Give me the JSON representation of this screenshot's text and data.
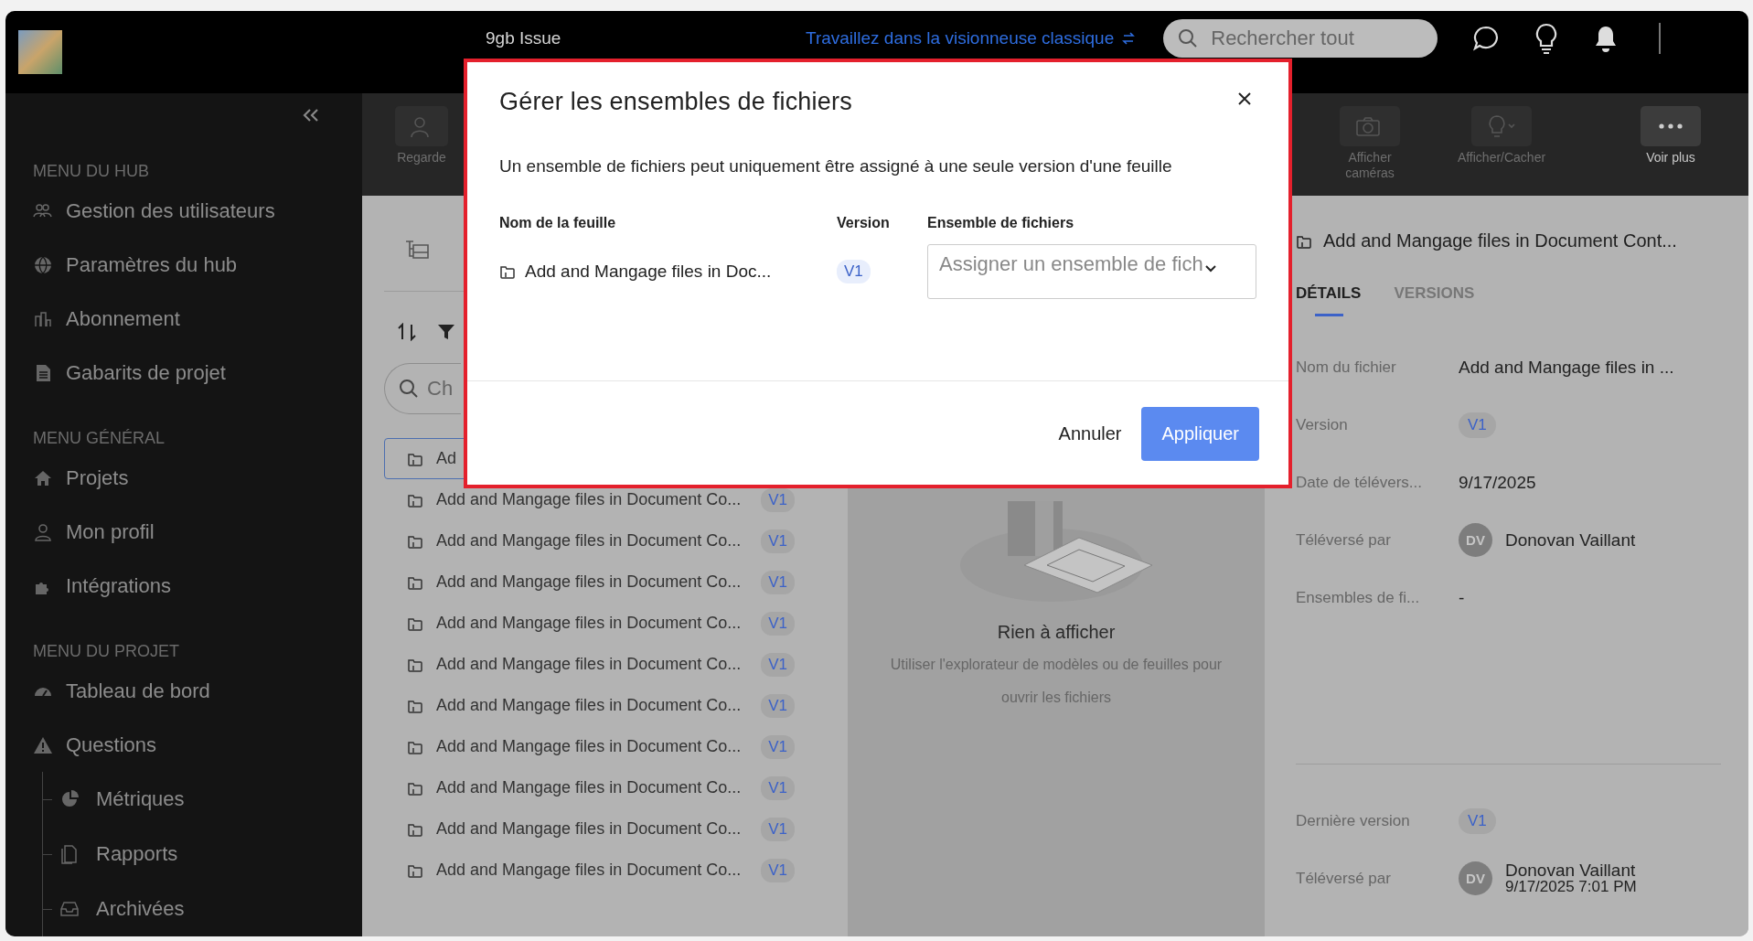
{
  "top_bar": {
    "project_title": "9gb Issue",
    "classic_viewer_link": "Travaillez dans la visionneuse classique",
    "search": {
      "placeholder": "Rechercher tout"
    }
  },
  "sidebar": {
    "sections": [
      {
        "heading": "MENU DU HUB",
        "items": [
          {
            "label": "Gestion des utilisateurs"
          },
          {
            "label": "Paramètres du hub"
          },
          {
            "label": "Abonnement"
          },
          {
            "label": "Gabarits de projet"
          }
        ]
      },
      {
        "heading": "MENU GÉNÉRAL",
        "items": [
          {
            "label": "Projets"
          },
          {
            "label": "Mon profil"
          },
          {
            "label": "Intégrations"
          }
        ]
      },
      {
        "heading": "MENU DU PROJET",
        "items": [
          {
            "label": "Tableau de bord"
          },
          {
            "label": "Questions",
            "children": [
              {
                "label": "Métriques"
              },
              {
                "label": "Rapports"
              },
              {
                "label": "Archivées"
              }
            ]
          }
        ]
      }
    ]
  },
  "toolbar": {
    "buttons": [
      {
        "label": "Regarde"
      },
      {
        "label": "Afficher caméras"
      },
      {
        "label": "Afficher/Cacher"
      },
      {
        "label": "Voir plus"
      }
    ]
  },
  "file_list": {
    "search": {
      "placeholder": "Ch"
    },
    "rows": [
      {
        "name": "Ad",
        "selected": true
      },
      {
        "name": "Add and Mangage files in Document Co...",
        "version": "V1",
        "selected": false
      },
      {
        "name": "Add and Mangage files in Document Co...",
        "version": "V1",
        "selected": false
      },
      {
        "name": "Add and Mangage files in Document Co...",
        "version": "V1",
        "selected": false
      },
      {
        "name": "Add and Mangage files in Document Co...",
        "version": "V1",
        "selected": false
      },
      {
        "name": "Add and Mangage files in Document Co...",
        "version": "V1",
        "selected": false
      },
      {
        "name": "Add and Mangage files in Document Co...",
        "version": "V1",
        "selected": false
      },
      {
        "name": "Add and Mangage files in Document Co...",
        "version": "V1",
        "selected": false
      },
      {
        "name": "Add and Mangage files in Document Co...",
        "version": "V1",
        "selected": false
      },
      {
        "name": "Add and Mangage files in Document Co...",
        "version": "V1",
        "selected": false
      },
      {
        "name": "Add and Mangage files in Document Co...",
        "version": "V1",
        "selected": false
      }
    ]
  },
  "viewer": {
    "title": "Rien à afficher",
    "message": "Utiliser l'explorateur de modèles ou de feuilles pour ouvrir les fichiers"
  },
  "details_panel": {
    "title": "Add and Mangage files in Document Cont...",
    "tabs": [
      {
        "label": "DÉTAILS",
        "selected": true
      },
      {
        "label": "VERSIONS",
        "selected": false
      }
    ],
    "fields": [
      {
        "label": "Nom du fichier",
        "kind": "text",
        "value": "Add and Mangage files in ..."
      },
      {
        "label": "Version",
        "kind": "badge",
        "value": "V1"
      },
      {
        "label": "Date de télévers...",
        "kind": "text",
        "value": "9/17/2025"
      },
      {
        "label": "Téléversé par",
        "kind": "user",
        "initials": "DV",
        "value": "Donovan Vaillant"
      },
      {
        "label": "Ensembles de fi...",
        "kind": "text",
        "value": "-"
      }
    ],
    "latest": [
      {
        "label": "Dernière version",
        "kind": "badge",
        "value": "V1"
      },
      {
        "label": "Téléversé par",
        "kind": "user",
        "initials": "DV",
        "value": "Donovan Vaillant",
        "date": "9/17/2025 7:01 PM"
      }
    ]
  },
  "dialog": {
    "title": "Gérer les ensembles de fichiers",
    "description": "Un ensemble de fichiers peut uniquement être assigné à une seule version d'une feuille",
    "columns": [
      "Nom de la feuille",
      "Version",
      "Ensemble de fichiers"
    ],
    "rows": [
      {
        "sheet": "Add and Mangage files in Doc...",
        "version": "V1",
        "file_set": {
          "placeholder": "Assigner un ensemble de fich"
        }
      }
    ],
    "buttons": [
      {
        "label": "Annuler",
        "kind": "secondary"
      },
      {
        "label": "Appliquer",
        "kind": "primary"
      }
    ]
  }
}
